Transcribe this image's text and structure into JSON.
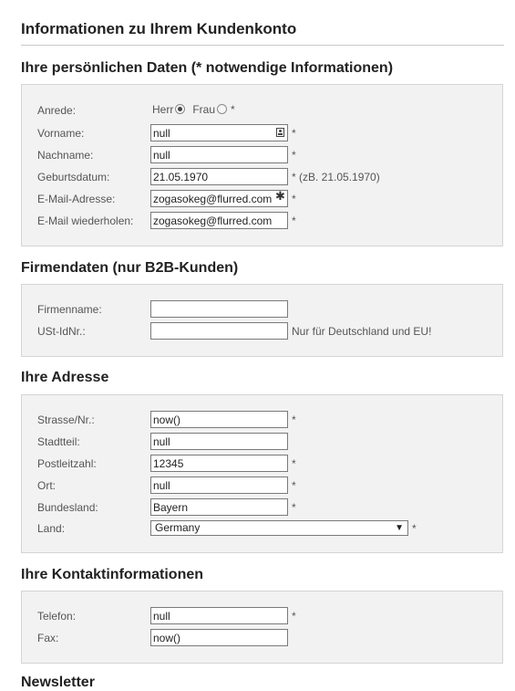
{
  "page_title": "Informationen zu Ihrem Kundenkonto",
  "required_mark": "*",
  "personal": {
    "title": "Ihre persönlichen Daten (* notwendige Informationen)",
    "salutation": {
      "label": "Anrede:",
      "options": [
        "Herr",
        "Frau"
      ],
      "selected": "Herr"
    },
    "first_name": {
      "label": "Vorname:",
      "value": "null"
    },
    "last_name": {
      "label": "Nachname:",
      "value": "null"
    },
    "birth_date": {
      "label": "Geburtsdatum:",
      "value": "21.05.1970",
      "hint": "* (zB. 21.05.1970)"
    },
    "email": {
      "label": "E-Mail-Adresse:",
      "value": "zogasokeg@flurred.com"
    },
    "email_repeat": {
      "label": "E-Mail wiederholen:",
      "value": "zogasokeg@flurred.com"
    }
  },
  "company": {
    "title": "Firmendaten (nur B2B-Kunden)",
    "company_name": {
      "label": "Firmenname:",
      "value": ""
    },
    "vat_id": {
      "label": "USt-IdNr.:",
      "value": "",
      "hint": "Nur für Deutschland und EU!"
    }
  },
  "address": {
    "title": "Ihre Adresse",
    "street": {
      "label": "Strasse/Nr.:",
      "value": "now()"
    },
    "district": {
      "label": "Stadtteil:",
      "value": "null"
    },
    "postcode": {
      "label": "Postleitzahl:",
      "value": "12345"
    },
    "city": {
      "label": "Ort:",
      "value": "null"
    },
    "state": {
      "label": "Bundesland:",
      "value": "Bayern"
    },
    "country": {
      "label": "Land:",
      "value": "Germany"
    }
  },
  "contact": {
    "title": "Ihre Kontaktinformationen",
    "phone": {
      "label": "Telefon:",
      "value": "null"
    },
    "fax": {
      "label": "Fax:",
      "value": "now()"
    }
  },
  "newsletter": {
    "title": "Newsletter"
  },
  "icons": {
    "contact_card": "contact-card-icon",
    "password_key": "key-icon",
    "dropdown": "chevron-down-icon"
  }
}
